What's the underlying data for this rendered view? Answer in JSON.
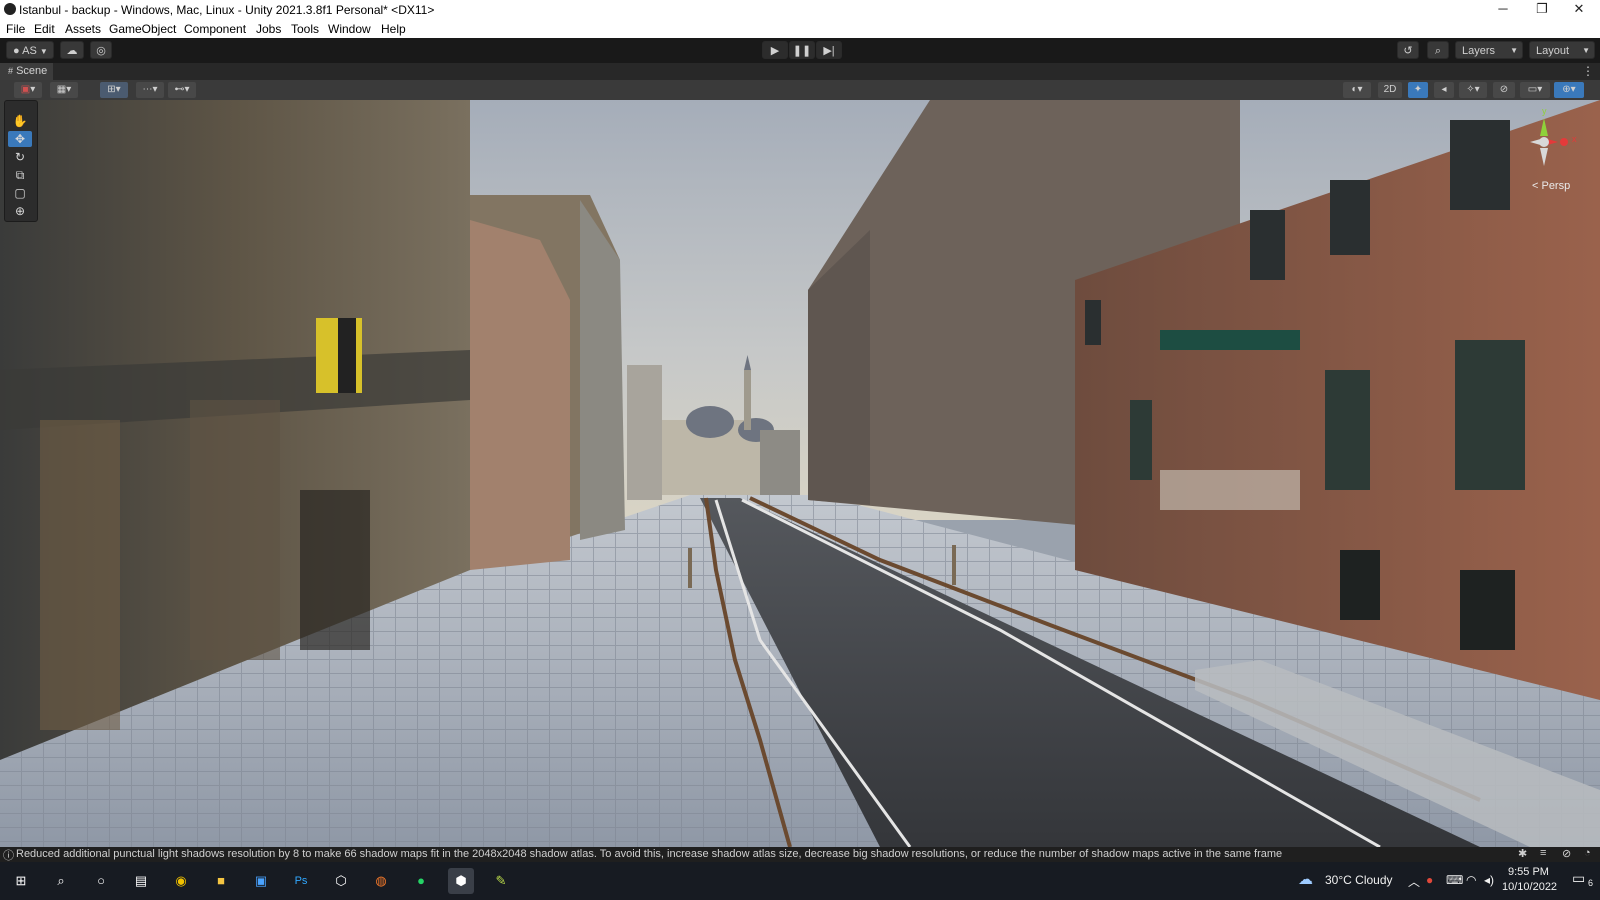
{
  "window": {
    "title": "Istanbul - backup - Windows, Mac, Linux - Unity 2021.3.8f1 Personal* <DX11>",
    "controls": {
      "minimize": "─",
      "maximize": "❐",
      "close": "✕"
    }
  },
  "menu": {
    "items": [
      "File",
      "Edit",
      "Assets",
      "GameObject",
      "Component",
      "Jobs",
      "Tools",
      "Window",
      "Help"
    ]
  },
  "toolbar": {
    "account": "AS",
    "play_icon": "play-icon",
    "pause_icon": "pause-icon",
    "step_icon": "step-icon",
    "layers": "Layers",
    "layout": "Layout"
  },
  "scene": {
    "tab_label": "Scene",
    "mode_2d": "2D",
    "projection": "< Persp",
    "gizmo_axes": {
      "y": "y",
      "x": "x"
    }
  },
  "status": {
    "message": "Reduced additional punctual light shadows resolution by 8 to make 66 shadow maps fit in the 2048x2048 shadow atlas. To avoid this, increase shadow atlas size, decrease big shadow resolutions, or reduce the number of shadow maps active in the same frame"
  },
  "taskbar": {
    "weather": "30°C  Cloudy",
    "time": "9:55 PM",
    "date": "10/10/2022",
    "notifications": "6",
    "ps_label": "Ps"
  },
  "colors": {
    "accent": "#3a79bb",
    "sky": "#aab3bf",
    "road": "#3e4045",
    "pavement": "#9fa7b3",
    "brick": "#8a5845"
  }
}
